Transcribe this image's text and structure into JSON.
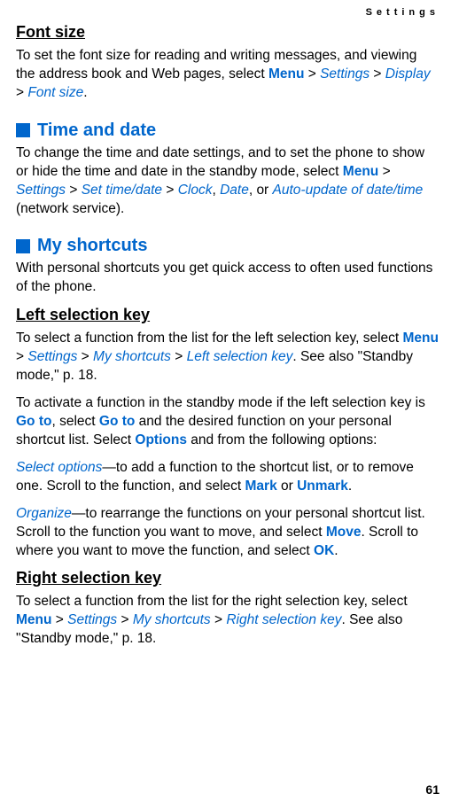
{
  "header": "Settings",
  "pagenum": "61",
  "sections": {
    "fontsize": {
      "title": "Font size",
      "p1a": "To set the font size for reading and writing messages, and viewing the address book and Web pages, select ",
      "menu": "Menu",
      "gt1": " > ",
      "settings": "Settings",
      "gt2": " > ",
      "display": "Display",
      "gt3": " > ",
      "fontsize": "Font size",
      "p1b": "."
    },
    "timedate": {
      "title": "Time and date",
      "p1a": "To change the time and date settings, and to set the phone to show or hide the time and date in the standby mode, select ",
      "menu": "Menu",
      "gt1": " > ",
      "settings": "Settings",
      "gt2": " > ",
      "settimedate": "Set time/date",
      "gt3": " > ",
      "clock": "Clock",
      "comma1": ", ",
      "date": "Date",
      "comma2": ", or ",
      "auto": "Auto-update of date/time",
      "p1b": " (network service)."
    },
    "shortcuts": {
      "title": "My shortcuts",
      "p1": "With personal shortcuts you get quick access to often used functions of the phone."
    },
    "leftkey": {
      "title": "Left selection key",
      "p1a": "To select a function from the list for the left selection key, select ",
      "menu": "Menu",
      "gt1": " > ",
      "settings": "Settings",
      "gt2": " > ",
      "myshortcuts": "My shortcuts",
      "gt3": " > ",
      "leftsel": "Left selection key",
      "p1b": ". See also \"Standby mode,\" p. 18.",
      "p2a": "To activate a function in the standby mode if the left selection key is ",
      "goto1": "Go to",
      "p2b": ", select ",
      "goto2": "Go to",
      "p2c": " and the desired function on your personal shortcut list. Select ",
      "options": "Options",
      "p2d": " and from the following options:",
      "selopt": "Select options",
      "p3a": "—to add a function to the shortcut list, or to remove one. Scroll to the function, and select ",
      "mark": "Mark",
      "p3b": " or ",
      "unmark": "Unmark",
      "p3c": ".",
      "organize": "Organize",
      "p4a": "—to rearrange the functions on your personal shortcut list. Scroll to the function you want to move, and select ",
      "move": "Move",
      "p4b": ". Scroll to where you want to move the function, and select ",
      "ok": "OK",
      "p4c": "."
    },
    "rightkey": {
      "title": "Right selection key",
      "p1a": "To select a function from the list for the right selection key, select ",
      "menu": "Menu",
      "gt1": " > ",
      "settings": "Settings",
      "gt2": " > ",
      "myshortcuts": "My shortcuts",
      "gt3": " > ",
      "rightsel": "Right selection key",
      "p1b": ". See also \"Standby mode,\" p. 18."
    }
  }
}
